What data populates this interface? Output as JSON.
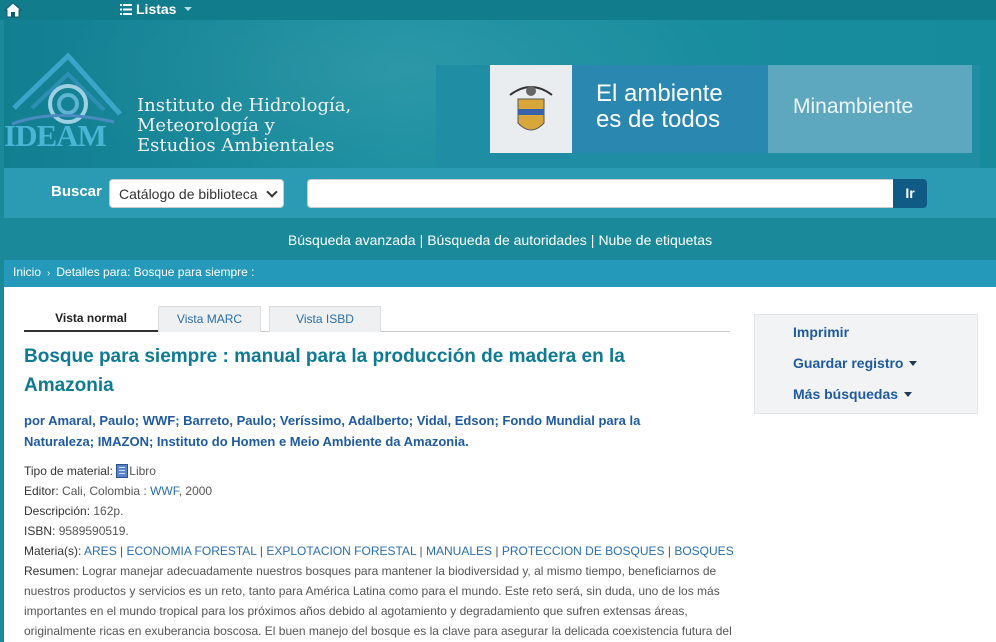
{
  "topnav": {
    "listas_label": "Listas",
    "home_icon": "home-icon",
    "list_icon": "list-icon"
  },
  "header": {
    "logo_text": "IDEAM",
    "institution": [
      "Instituto de Hidrología,",
      "Meteorología y",
      "Estudios Ambientales"
    ],
    "slogan": [
      "El ambiente",
      "es de todos"
    ],
    "ministry": "Minambiente"
  },
  "search": {
    "label": "Buscar",
    "catalog_option": "Catálogo de biblioteca",
    "query": "",
    "go_label": "Ir"
  },
  "more_links": [
    "Búsqueda avanzada",
    "Búsqueda de autoridades",
    "Nube de etiquetas"
  ],
  "breadcrumb": {
    "home": "Inicio",
    "current": "Detalles para: Bosque para siempre :"
  },
  "tabs": [
    {
      "label": "Vista normal"
    },
    {
      "label": "Vista MARC"
    },
    {
      "label": "Vista ISBD"
    }
  ],
  "record": {
    "title_line1": "Bosque para siempre : manual para la producción de madera en la",
    "title_line2": "Amazonia",
    "authors_line1": "por Amaral, Paulo; WWF; Barreto, Paulo; Veríssimo, Adalberto; Vidal, Edson; Fondo Mundial para la",
    "authors_line2": "Naturaleza; IMAZON; Instituto do Homen e Meio Ambiente da Amazonia.",
    "material_label": "Tipo de material:",
    "material_value": "Libro",
    "editor_label": "Editor:",
    "editor_place": "Cali, Colombia :",
    "editor_name": "WWF",
    "editor_year": ", 2000",
    "description_label": "Descripción:",
    "description_value": "162p.",
    "isbn_label": "ISBN:",
    "isbn_value": "9589590519.",
    "subjects_label": "Materia(s):",
    "subjects": [
      "ARES",
      "ECONOMIA FORESTAL",
      "EXPLOTACION FORESTAL",
      "MANUALES",
      "PROTECCION DE BOSQUES",
      "BOSQUES"
    ],
    "summary_label": "Resumen:",
    "summary_lines": [
      "Lograr manejar adecuadamente nuestros bosques para mantener la biodiversidad y, al mismo tiempo, beneficiarnos de",
      "nuestros productos y servicios es un reto, tanto para América Latina como para el mundo. Este reto será, sin duda, uno de los más",
      "importantes en el mundo tropical para los próximos años debido al agotamiento y degradamiento que sufren extensas áreas,",
      "originalmente ricas en exuberancia boscosa. El buen manejo del bosque es la clave para asegurar la delicada coexistencia futura del"
    ]
  },
  "sidebar": {
    "print": "Imprimir",
    "save": "Guardar registro",
    "more": "Más búsquedas"
  }
}
